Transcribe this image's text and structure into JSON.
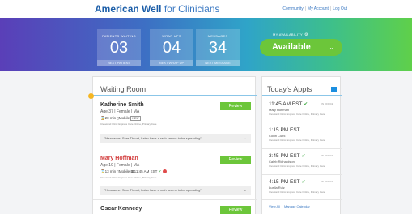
{
  "header": {
    "brand_bold": "American Well",
    "brand_rest": " for Clinicians",
    "nav": [
      "Community",
      "My Account",
      "Log Out"
    ]
  },
  "stats": [
    {
      "label": "PATIENTS WAITING",
      "value": "03",
      "button": "NEXT PATIENT"
    },
    {
      "label": "WRAP UPS",
      "value": "04",
      "button": "NEXT WRAP UP"
    },
    {
      "label": "MESSAGES",
      "value": "34",
      "button": "NEXT MESSAGE"
    }
  ],
  "availability": {
    "label": "MY AVAILABILITY",
    "value": "Available"
  },
  "waiting_room": {
    "title": "Waiting Room",
    "review_label": "Review",
    "patients": [
      {
        "name": "Katherine Smith",
        "meta": "Age 37 | Female | MA",
        "wait": "20 min",
        "device": "Mobile",
        "tag": "NEW",
        "appt": "",
        "details": "Cleveland Clinic Express Care Online, Primary Care",
        "quote": "\"Headache, Sore Throat, I also have a rash seems to be spreading\""
      },
      {
        "name": "Mary Hoffman",
        "meta": "Age 19 | Female | MA",
        "wait": "13 min",
        "device": "Mobile",
        "tag": "",
        "appt": "11:45 AM EST",
        "details": "Cleveland Clinic Express Care Online, Primary Care",
        "quote": "\"Headache, Sore Throat, I also have a rash seems to be spreading\""
      },
      {
        "name": "Oscar Kennedy"
      }
    ]
  },
  "todays_appts": {
    "title": "Today's Appts",
    "items": [
      {
        "time": "11:45 AM EST",
        "name": "Mary Hoffman",
        "desc": "Cleveland Clinic Express Care Online, Primary Care",
        "status": "IN OFFICE"
      },
      {
        "time": "1:15 PM EST",
        "name": "Collin Clark",
        "desc": "Cleveland Clinic Express Care Online, Primary Care",
        "status": ""
      },
      {
        "time": "3:45 PM EST",
        "name": "Caleb Richardson",
        "desc": "Cleveland Clinic Express Care Online, Primary Care",
        "status": "IN OFFICE"
      },
      {
        "time": "4:15 PM EST",
        "name": "Luella Ruiz",
        "desc": "Cleveland Clinic Express Care Online, Primary Care",
        "status": "IN OFFICE"
      }
    ],
    "view_all": "View All",
    "manage": "Manage Calendar"
  }
}
